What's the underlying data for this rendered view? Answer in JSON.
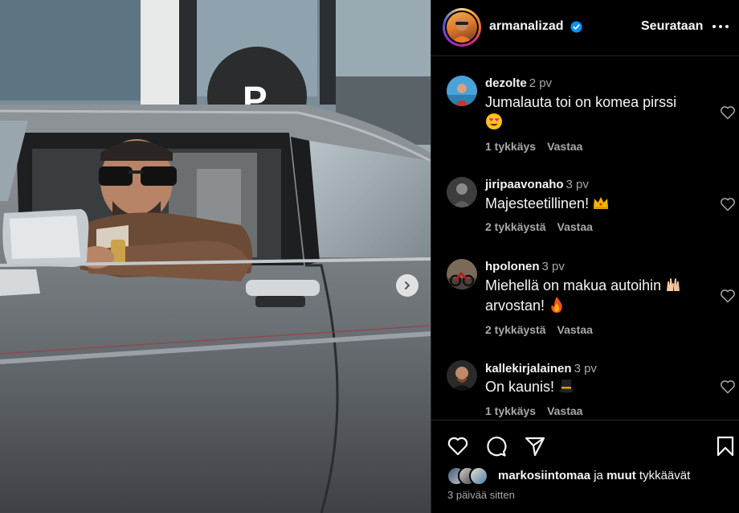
{
  "post": {
    "username": "armanalizad",
    "verified": true,
    "follow_state": "Seurataan",
    "more_icon": "more-horizontal-icon"
  },
  "comments": [
    {
      "username": "dezolte",
      "time": "2 pv",
      "text": "Jumalauta toi on komea pirssi",
      "emoji": "heart-eyes-emoji",
      "likes": "1 tykkäys",
      "reply": "Vastaa"
    },
    {
      "username": "jiripaavonaho",
      "time": "3 pv",
      "text": "Majesteetillinen!",
      "emoji": "crown-emoji",
      "likes": "2 tykkäystä",
      "reply": "Vastaa"
    },
    {
      "username": "hpolonen",
      "time": "3 pv",
      "text": "Miehellä on makua autoihin",
      "text2": "arvostan!",
      "emoji": "raising-hands-emoji",
      "emoji2": "fire-emoji",
      "likes": "2 tykkäystä",
      "reply": "Vastaa"
    },
    {
      "username": "kallekirjalainen",
      "time": "3 pv",
      "text": "On kaunis!",
      "emoji": "top-hat-emoji",
      "likes": "1 tykkäys",
      "reply": "Vastaa"
    }
  ],
  "likes": {
    "user": "markosiintomaa",
    "connector": "ja",
    "others": "muut",
    "suffix": "tykkäävät"
  },
  "post_time": "3 päivää sitten",
  "colors": {
    "background": "#000000",
    "text": "#f5f5f5",
    "secondary_text": "#a8a8a8",
    "verified_blue": "#0095f6",
    "divider": "#262626"
  }
}
